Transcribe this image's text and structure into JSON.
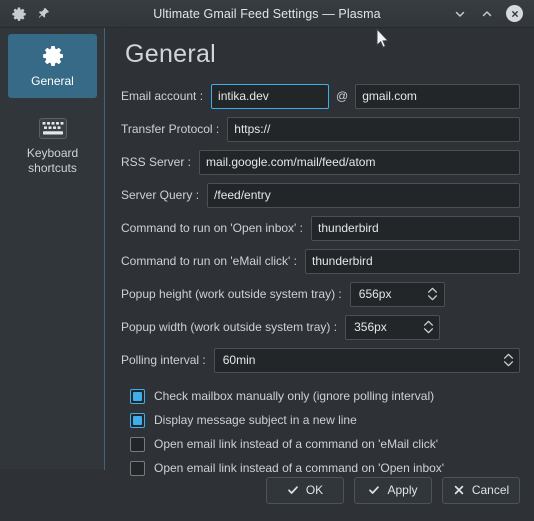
{
  "window": {
    "title": "Ultimate Gmail Feed Settings — Plasma",
    "titlebar_icons": {
      "config": "gear-icon",
      "pin": "pin-icon",
      "minimize": "chevron-down-icon",
      "maximize": "chevron-up-icon",
      "close": "close-circle-icon"
    },
    "accent_color": "#3daee9",
    "selection_color": "#366a86",
    "background_color": "#2e3236",
    "sidebar_color": "#31363b",
    "field_color": "#232629"
  },
  "sidebar": {
    "items": [
      {
        "label": "General",
        "icon": "gear-icon",
        "selected": true
      },
      {
        "label": "Keyboard\nshortcuts",
        "label_line1": "Keyboard",
        "label_line2": "shortcuts",
        "icon": "keyboard-icon",
        "selected": false
      }
    ]
  },
  "main": {
    "heading": "General",
    "fields": {
      "email_account": {
        "label": "Email account :",
        "value": "intika.dev",
        "focused": true,
        "separator": "@",
        "domain_value": "gmail.com"
      },
      "transfer_protocol": {
        "label": "Transfer Protocol :",
        "value": "https://"
      },
      "rss_server": {
        "label": "RSS Server :",
        "value": "mail.google.com/mail/feed/atom"
      },
      "server_query": {
        "label": "Server Query :",
        "value": "/feed/entry"
      },
      "command_open_inbox": {
        "label": "Command to run on 'Open inbox' :",
        "value": "thunderbird"
      },
      "command_email_click": {
        "label": "Command to run on 'eMail click' :",
        "value": "thunderbird"
      },
      "popup_height": {
        "label": "Popup height (work outside system tray) :",
        "value": "656px"
      },
      "popup_width": {
        "label": "Popup width (work outside system tray) :",
        "value": "356px"
      },
      "polling_interval": {
        "label": "Polling interval :",
        "value": "60min"
      }
    },
    "checkboxes": [
      {
        "label": "Check mailbox manually only (ignore polling interval)",
        "checked": true
      },
      {
        "label": "Display message subject in a new line",
        "checked": true
      },
      {
        "label": "Open email link instead of a command on 'eMail click'",
        "checked": false
      },
      {
        "label": "Open email link instead of a command on 'Open inbox'",
        "checked": false
      }
    ]
  },
  "footer": {
    "buttons": [
      {
        "label": "OK",
        "icon": "check-icon"
      },
      {
        "label": "Apply",
        "icon": "check-icon"
      },
      {
        "label": "Cancel",
        "icon": "cross-icon"
      }
    ]
  }
}
